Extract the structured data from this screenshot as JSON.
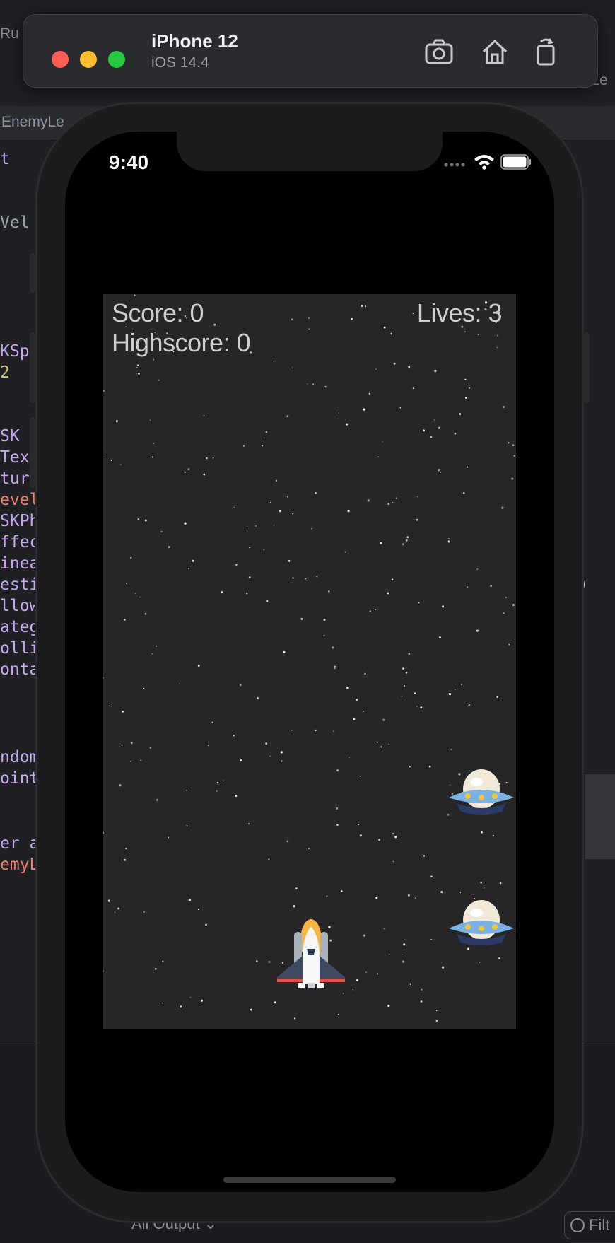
{
  "simulator": {
    "device_name": "iPhone 12",
    "os_version": "iOS 14.4",
    "toolbar_icons": [
      "screenshot-icon",
      "home-icon",
      "rotate-icon"
    ]
  },
  "status_bar": {
    "time": "9:40"
  },
  "game": {
    "score_label": "Score: 0",
    "highscore_label": "Highscore: 0",
    "lives_label": "Lives: 3",
    "sprites": [
      "spaceship",
      "ufo",
      "ufo"
    ]
  },
  "background_editor": {
    "tab_fragment": "EnemyLe",
    "top_left_fragment": "Ru",
    "top_right_fragment": "y Le",
    "right_fragment": ")",
    "code_fragments": [
      {
        "text": "t",
        "cls": "code-purple"
      },
      {
        "text": "Vel",
        "cls": "code-gray"
      },
      {
        "text": "KSp",
        "cls": "code-purple"
      },
      {
        "text": "2",
        "cls": "code-yellow"
      },
      {
        "text": " SK",
        "cls": "code-purple"
      },
      {
        "text": "Text",
        "cls": "code-purple"
      },
      {
        "text": "ture",
        "cls": "code-purple"
      },
      {
        "text": "evel",
        "cls": "code-red"
      },
      {
        "text": "SKPh",
        "cls": "code-purple"
      },
      {
        "text": "ffec",
        "cls": "code-purple"
      },
      {
        "text": "inea",
        "cls": "code-purple"
      },
      {
        "text": "esti",
        "cls": "code-purple"
      },
      {
        "text": "llow",
        "cls": "code-purple"
      },
      {
        "text": "ateg",
        "cls": "code-purple"
      },
      {
        "text": "olli",
        "cls": "code-purple"
      },
      {
        "text": "onta",
        "cls": "code-purple"
      },
      {
        "text": "ndom",
        "cls": "code-purple"
      },
      {
        "text": "oint",
        "cls": "code-purple"
      },
      {
        "text": "er a",
        "cls": "code-purple"
      },
      {
        "text": "emyL",
        "cls": "code-red"
      }
    ],
    "output_selector": "All Output ⌄",
    "filter_label": "Filt"
  },
  "colors": {
    "game_background": "#262628",
    "hud_text": "#cfcfd2",
    "close": "#ff5f57",
    "minimize": "#febc2e",
    "maximize": "#28c840"
  }
}
